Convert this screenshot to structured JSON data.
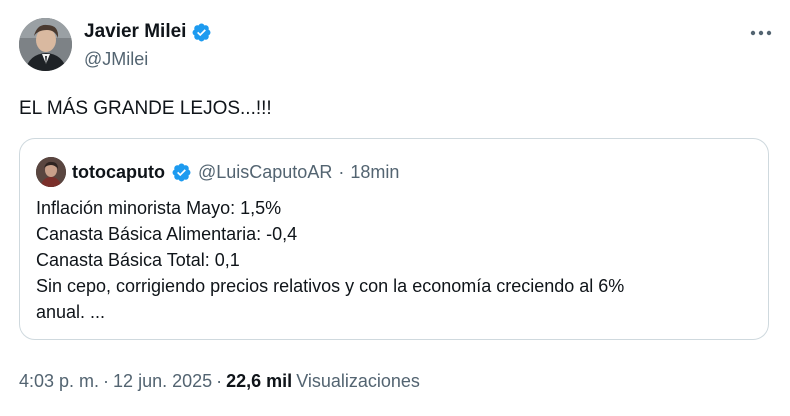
{
  "author": {
    "name": "Javier Milei",
    "handle": "@JMilei",
    "verified_color": "#1d9bf0"
  },
  "more_icon": "more-horizontal-icon",
  "tweet": {
    "text": "EL MÁS GRANDE LEJOS...!!!"
  },
  "quote": {
    "name": "totocaputo",
    "handle": "@LuisCaputoAR",
    "separator": "·",
    "time": "18min",
    "lines": [
      "Inflación minorista Mayo: 1,5%",
      "Canasta Básica Alimentaria: -0,4",
      "Canasta Básica Total: 0,1",
      "Sin cepo, corrigiendo precios relativos y con la economía creciendo al 6%",
      "anual. ..."
    ]
  },
  "footer": {
    "time": "4:03 p. m.",
    "separator1": "·",
    "date": "12 jun. 2025",
    "separator2": "·",
    "views_count": "22,6 mil",
    "views_label": "Visualizaciones"
  }
}
